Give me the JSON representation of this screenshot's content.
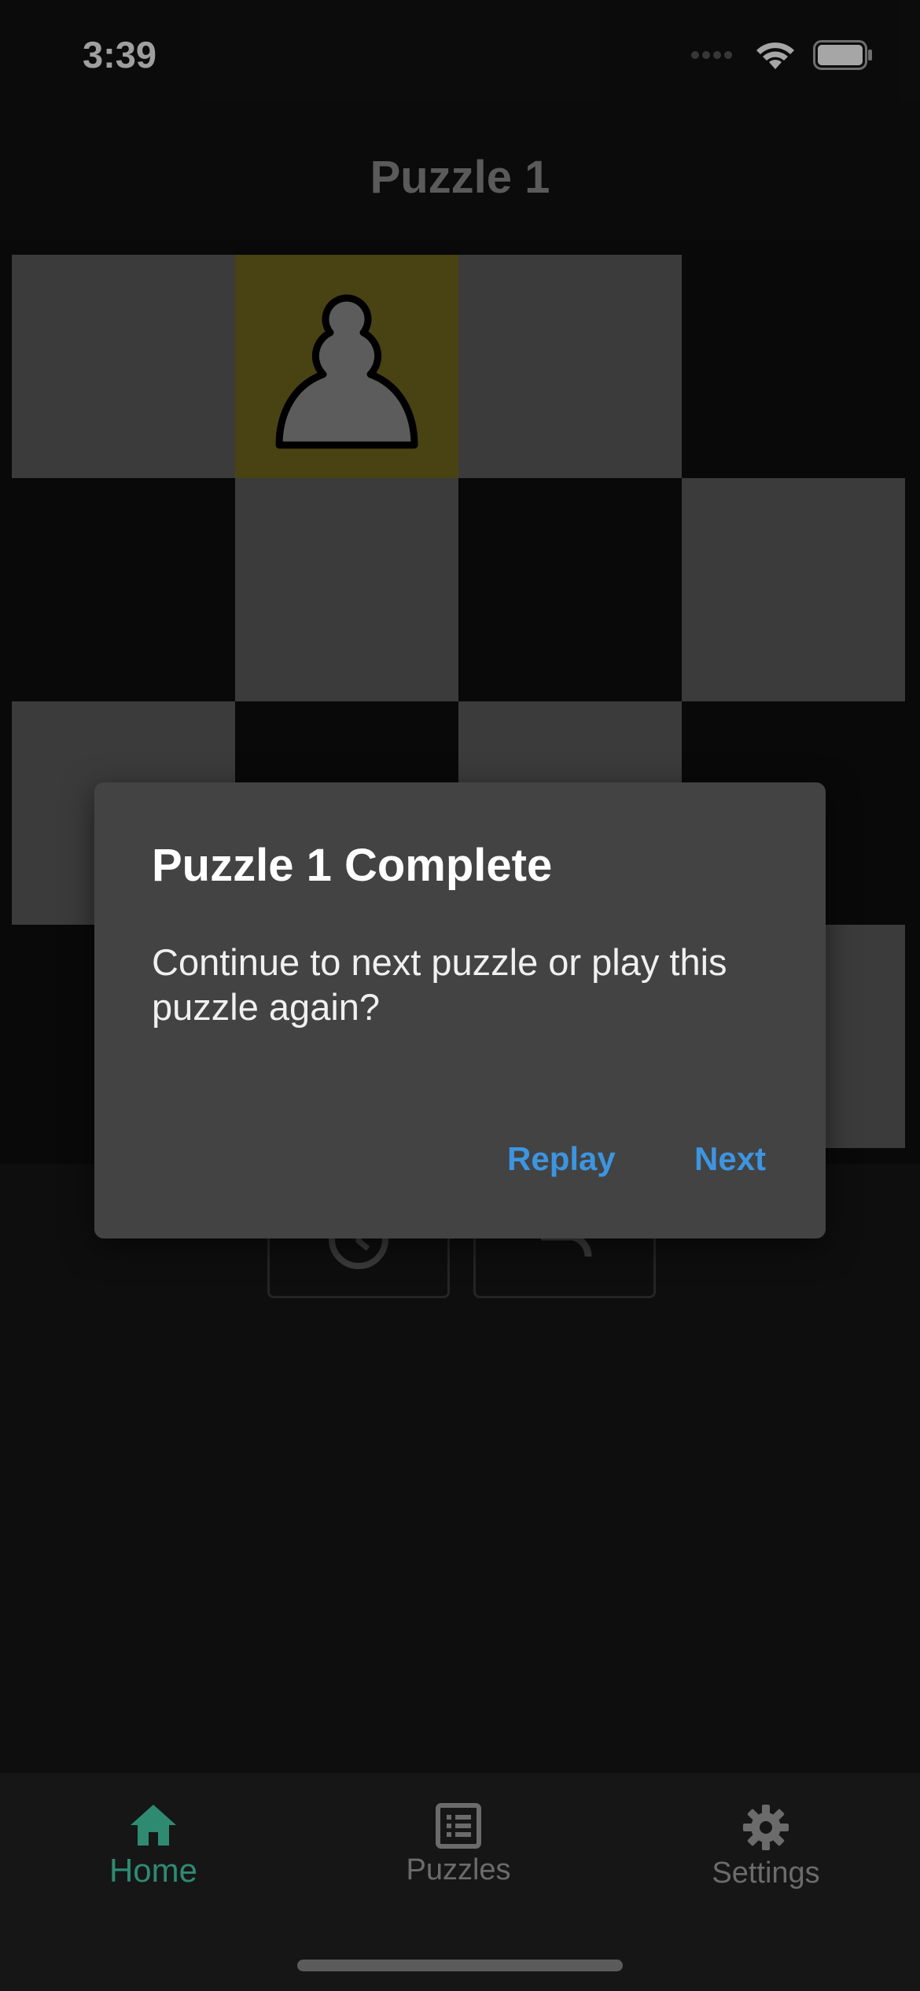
{
  "status": {
    "time": "3:39"
  },
  "nav": {
    "title": "Puzzle 1"
  },
  "board": {
    "colors": {
      "light": "#5b5b5b",
      "dark": "#0e0e0e",
      "highlight": "#71681f"
    },
    "piece": {
      "type": "pawn",
      "color": "white",
      "square": "b-top-row"
    }
  },
  "dialog": {
    "title": "Puzzle 1 Complete",
    "message": "Continue to next puzzle or play this puzzle again?",
    "replay_label": "Replay",
    "next_label": "Next"
  },
  "tabs": [
    {
      "label": "Home",
      "icon": "home-icon",
      "active": true,
      "color": "#2f8a72"
    },
    {
      "label": "Puzzles",
      "icon": "list-icon",
      "active": false,
      "color": "#6b6b6b"
    },
    {
      "label": "Settings",
      "icon": "gear-icon",
      "active": false,
      "color": "#6b6b6b"
    }
  ]
}
